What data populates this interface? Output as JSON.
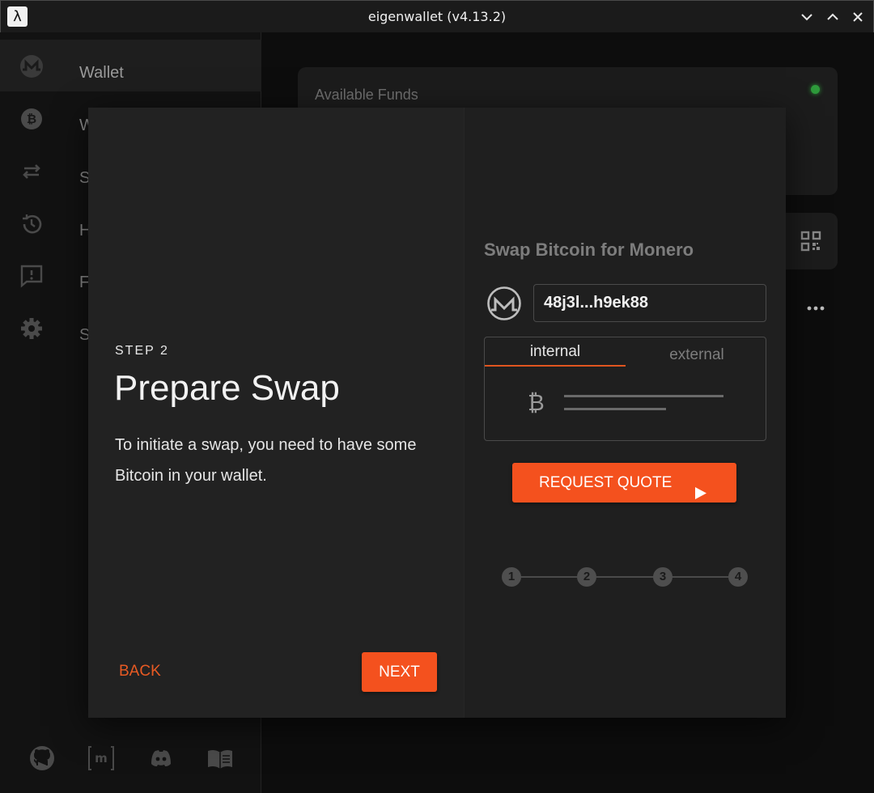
{
  "window": {
    "title": "eigenwallet (v4.13.2)",
    "app_icon": "λ"
  },
  "sidebar": {
    "items": [
      {
        "label": "Wallet",
        "icon": "monero-icon"
      },
      {
        "label": "W",
        "icon": "bitcoin-icon"
      },
      {
        "label": "S",
        "icon": "swap-icon"
      },
      {
        "label": "H",
        "icon": "history-icon"
      },
      {
        "label": "F",
        "icon": "feedback-icon"
      },
      {
        "label": "S",
        "icon": "settings-icon"
      }
    ],
    "footer_icons": [
      "github-icon",
      "matrix-icon",
      "discord-icon",
      "docs-icon"
    ]
  },
  "main": {
    "funds_label": "Available Funds"
  },
  "dialog": {
    "step_label": "STEP 2",
    "title": "Prepare Swap",
    "body": "To initiate a swap, you need to have some Bitcoin in your wallet.",
    "back_label": "BACK",
    "next_label": "NEXT",
    "illustration": {
      "title": "Swap Bitcoin for Monero",
      "address": "48j3l...h9ek88",
      "tabs": [
        "internal",
        "external"
      ],
      "btc_symbol": "₿",
      "quote_label": "REQUEST QUOTE",
      "steps": [
        "1",
        "2",
        "3",
        "4"
      ]
    }
  },
  "colors": {
    "accent": "#f4511e",
    "status_online": "#2e9a3b"
  }
}
